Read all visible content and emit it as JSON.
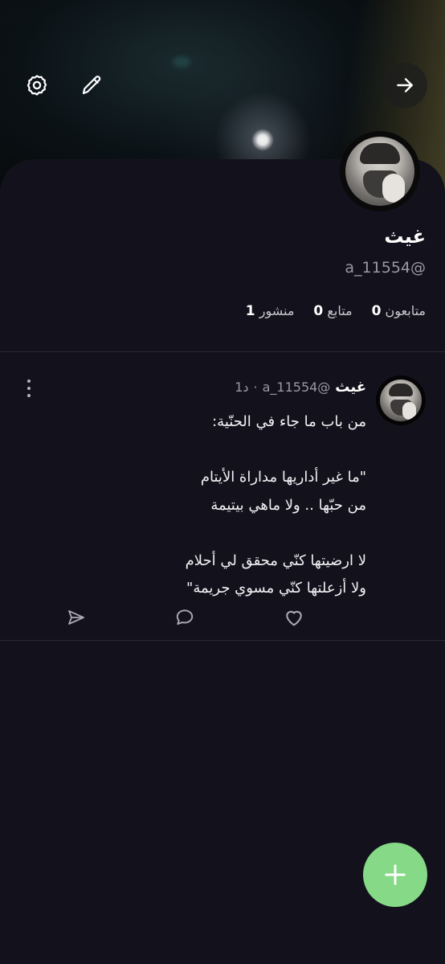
{
  "header": {
    "settings_icon": "gear-icon",
    "edit_icon": "pencil-icon",
    "back_icon": "arrow-right-icon"
  },
  "profile": {
    "name": "غيث",
    "handle": "a_11554@",
    "stats": [
      {
        "value": "0",
        "label": "متابعون"
      },
      {
        "value": "0",
        "label": "متابع"
      },
      {
        "value": "1",
        "label": "منشور"
      }
    ]
  },
  "post": {
    "author": "غيث",
    "handle": "a_11554@",
    "separator": "·",
    "time": "1د",
    "body": "من باب ما جاء في الحنّية:\n\n\"ما غير أداريها مداراة الأيتام\nمن حبّها .. ولا ماهي بيتيمة\n\nلا ارضيتها كنّي محقق لي أحلام\nولا أزعلتها كنّي مسوي جريمة\""
  },
  "colors": {
    "background": "#13121c",
    "accent_fab": "#86d986",
    "muted_text": "#9a99a3"
  }
}
